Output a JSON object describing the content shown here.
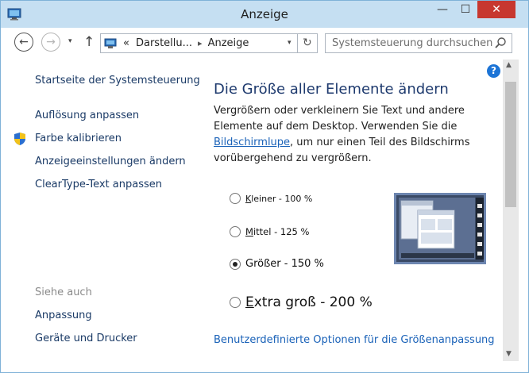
{
  "window": {
    "title": "Anzeige",
    "minimize_glyph": "—",
    "maximize_glyph": "☐",
    "close_glyph": "✕"
  },
  "nav": {
    "back_glyph": "←",
    "forward_glyph": "→",
    "dropdown_glyph": "▾",
    "up_glyph": "↑",
    "address": {
      "overflow_glyph": "«",
      "separator_glyph": "▸",
      "crumbs": [
        "Darstellu...",
        "Anzeige"
      ],
      "dropdown_glyph": "▾",
      "refresh_glyph": "↻"
    },
    "search": {
      "placeholder": "Systemsteuerung durchsuchen"
    }
  },
  "sidebar": {
    "home": "Startseite der Systemsteuerung",
    "items": [
      "Auflösung anpassen",
      "Farbe kalibrieren",
      "Anzeigeeinstellungen ändern",
      "ClearType-Text anpassen"
    ],
    "see_also": {
      "heading": "Siehe auch",
      "items": [
        "Anpassung",
        "Geräte und Drucker"
      ]
    }
  },
  "main": {
    "help_glyph": "?",
    "heading": "Die Größe aller Elemente ändern",
    "desc_part1": "Vergrößern oder verkleinern Sie Text und andere Elemente auf dem Desktop. Verwenden Sie die ",
    "desc_link": "Bildschirmlupe",
    "desc_part2": ", um nur einen Teil des Bildschirms vorübergehend zu vergrößern.",
    "options": [
      {
        "label": "Kleiner - 100 %",
        "checked": false
      },
      {
        "label": "Mittel - 125 %",
        "checked": false
      },
      {
        "label": "Größer - 150 %",
        "checked": true
      },
      {
        "label": "Extra groß - 200 %",
        "checked": false
      }
    ],
    "custom_link": "Benutzerdefinierte Optionen für die Größenanpassung"
  },
  "colors": {
    "titlebar": "#c5dff2",
    "close_button": "#c7372f",
    "link": "#1a62b8",
    "heading": "#1e3a6e"
  },
  "icons": {
    "app": "control-panel-icon",
    "shield": "uac-shield-icon",
    "search": "search-icon",
    "help": "help-icon",
    "preview": "display-preview-icon"
  }
}
